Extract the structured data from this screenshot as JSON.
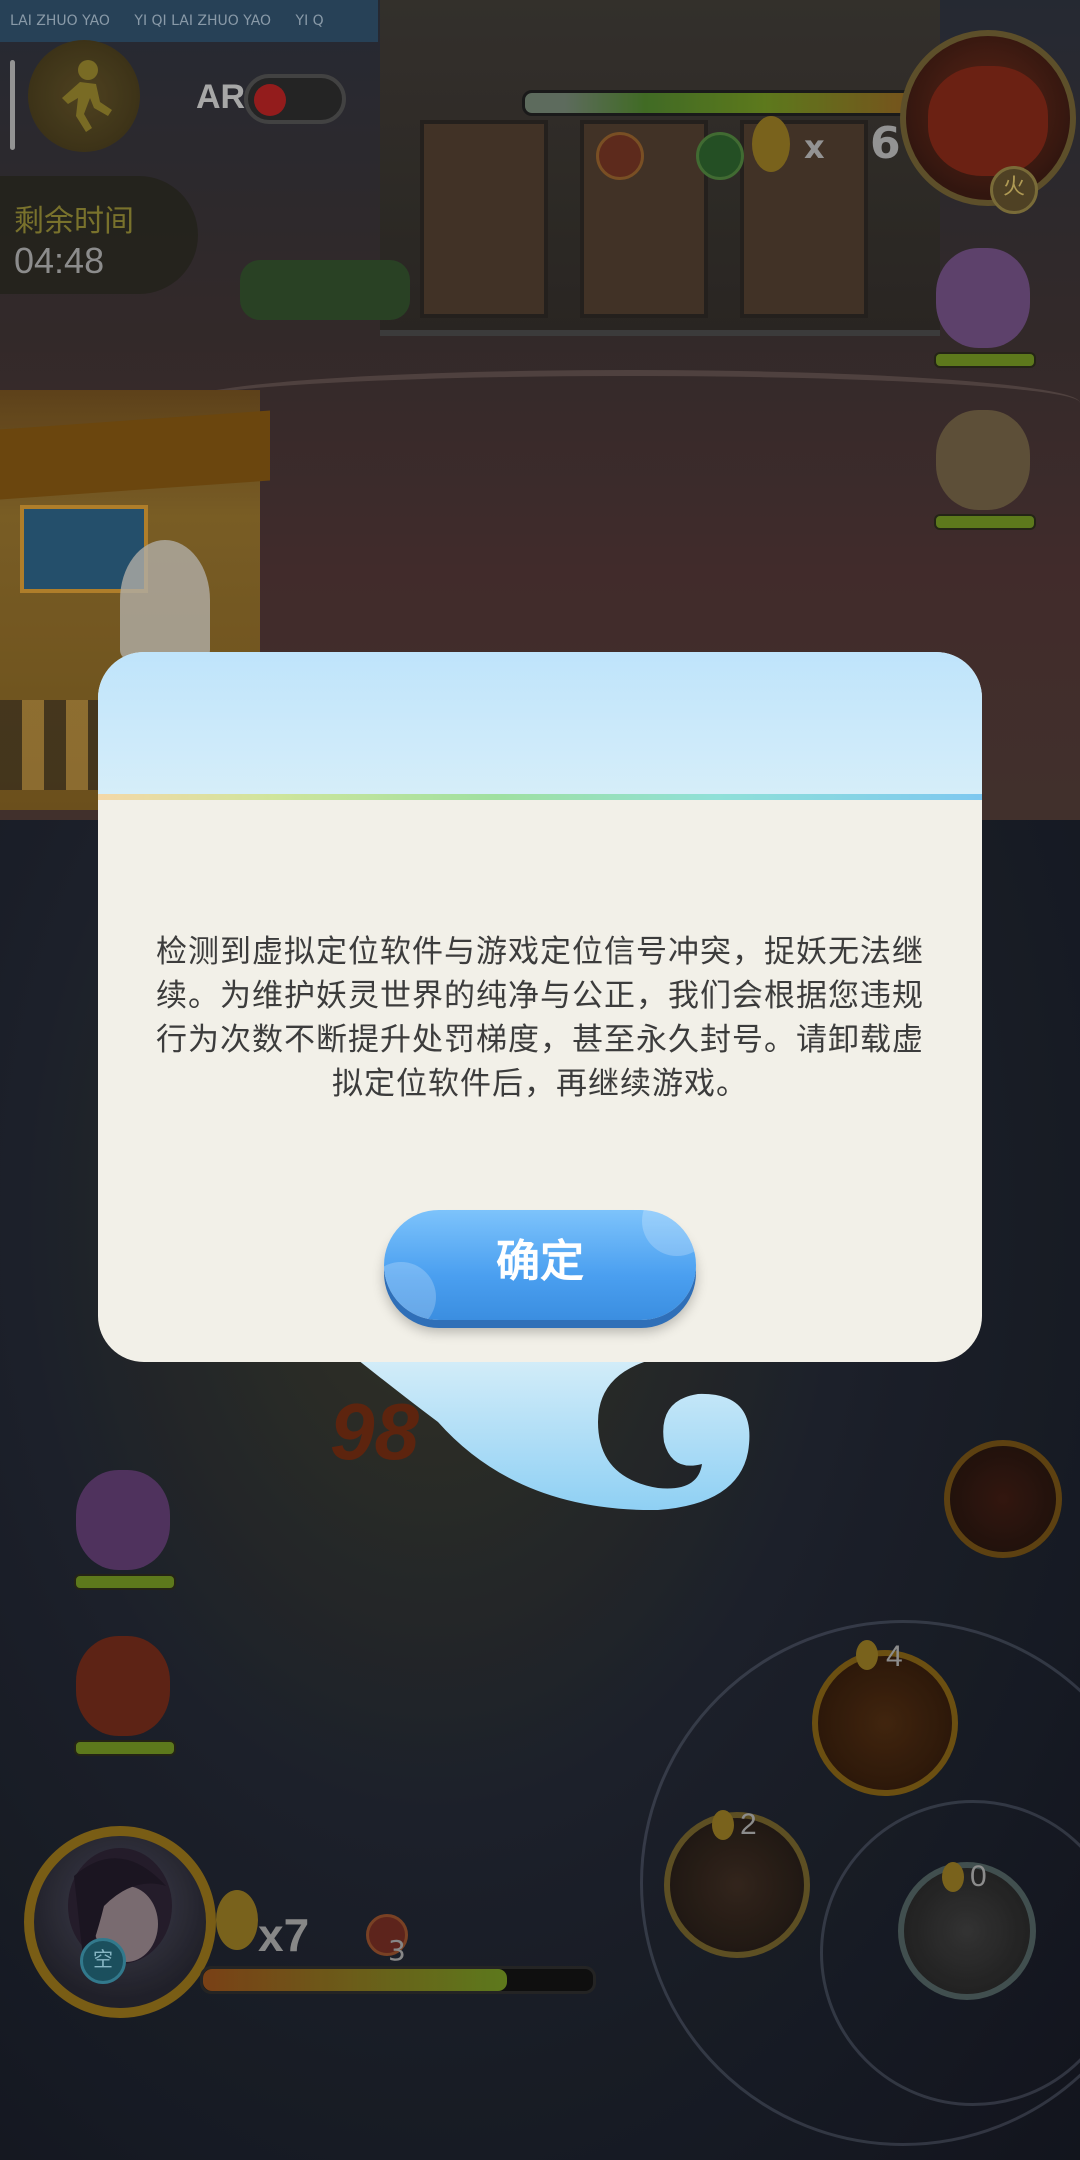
{
  "hud": {
    "ticker_segments": [
      "LAI ZHUO YAO",
      "YI QI LAI ZHUO YAO",
      "YI Q"
    ],
    "ar_label": "AR",
    "ar_toggle_on": false,
    "time_label": "剩余时间",
    "time_value": "04:48",
    "resource_count_prefix": "x",
    "resource_count": "6",
    "enemy_element_tag": "火",
    "player_element_tag": "空",
    "player_item_count": "x7",
    "player_ball_count": "3",
    "damage_number": "98"
  },
  "skills": {
    "skill_1_count": "4",
    "skill_2_count": "2",
    "skill_3_count": "0"
  },
  "dialog": {
    "message": "检测到虚拟定位软件与游戏定位信号冲突，捉妖无法继续。为维护妖灵世界的纯净与公正，我们会根据您违规行为次数不断提升处罚梯度，甚至永久封号。请卸载虚拟定位软件后，再继续游戏。",
    "confirm_label": "确定"
  },
  "colors": {
    "dialog_bg": "#f2f0e8",
    "dialog_header": "#bfe4fb",
    "button_blue": "#4a9ff0",
    "hud_gold": "#8a6a18"
  }
}
